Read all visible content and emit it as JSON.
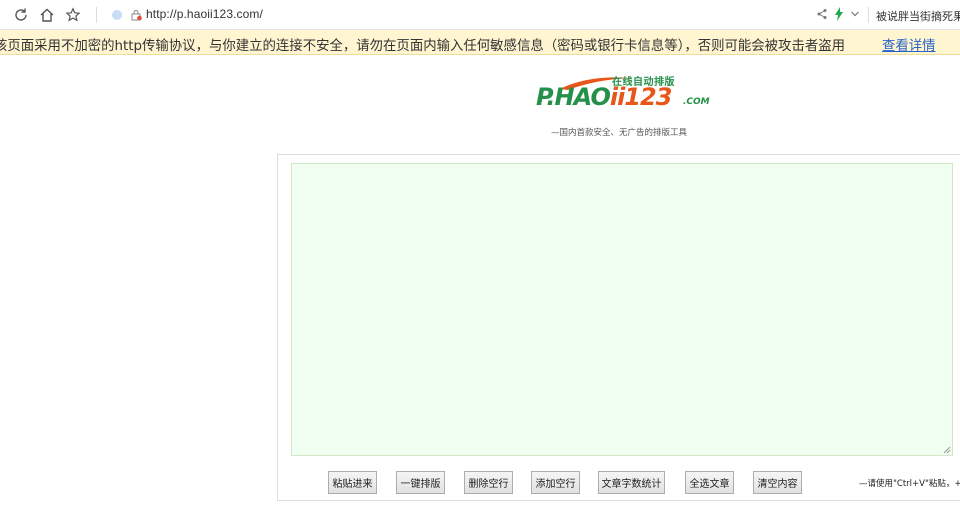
{
  "browser": {
    "url": "http://p.haoii123.com/",
    "search_text": "被说胖当街摘死果"
  },
  "security_bar": {
    "message": "该页面采用不加密的http传输协议，与你建立的连接不安全，请勿在页面内输入任何敏感信息（密码或银行卡信息等），否则可能会被攻击者盗用",
    "link": "查看详情"
  },
  "logo": {
    "main_prefix": "P.HAO",
    "main_suffix": "ii123",
    "domain": ".COM",
    "slogan": "在线自动排版"
  },
  "tagline": "—国内首款安全、无广告的排版工具",
  "editor": {
    "value": ""
  },
  "buttons": {
    "paste": "粘贴进来",
    "format": "一键排版",
    "delete_blank": "删除空行",
    "add_blank": "添加空行",
    "count": "文章字数统计",
    "select_all": "全选文章",
    "clear": "清空内容"
  },
  "hint": "—请使用\"Ctrl+V\"粘贴，+C复制",
  "colors": {
    "logo_green": "#25904a",
    "logo_orange": "#e8561a",
    "editor_bg": "#f0fff0",
    "secbar_bg": "#fff5d1",
    "link": "#2a63c7"
  }
}
